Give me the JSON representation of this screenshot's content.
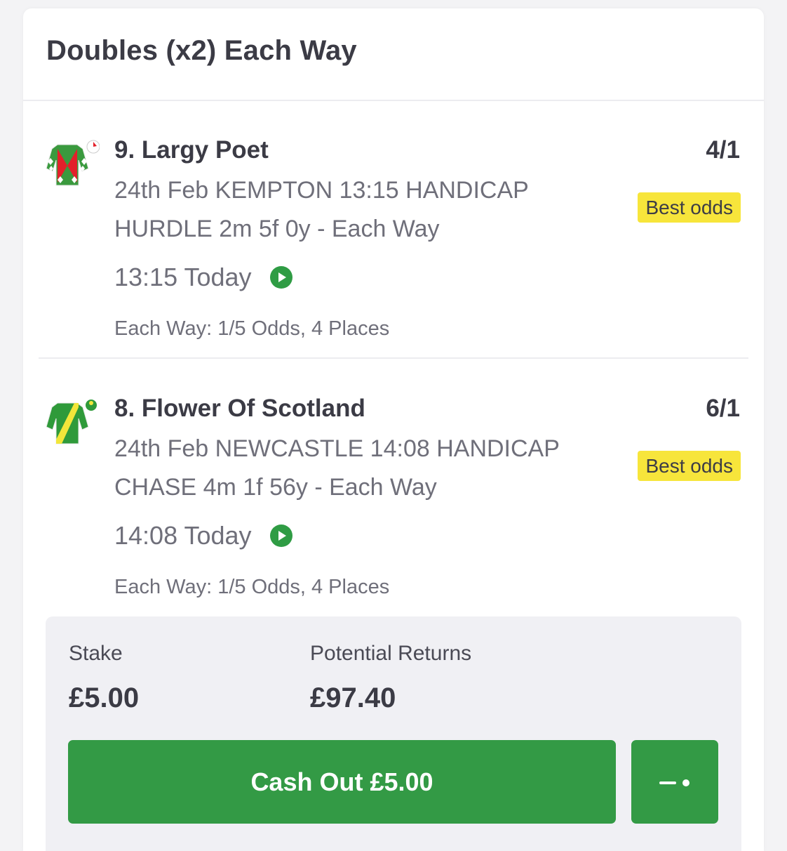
{
  "header": {
    "title": "Doubles (x2) Each Way"
  },
  "selections": [
    {
      "name": "9. Largy Poet",
      "odds": "4/1",
      "event": "24th Feb KEMPTON 13:15 HANDICAP HURDLE 2m 5f 0y - Each Way",
      "badge": "Best odds",
      "time": "13:15 Today",
      "each_way_terms": "Each Way: 1/5 Odds, 4 Places",
      "silk_icon": "jockey-silks-icon",
      "colors": {
        "body": "#3a9a3e",
        "accent": "#e3202a",
        "cap": "#ffffff"
      }
    },
    {
      "name": "8. Flower Of Scotland",
      "odds": "6/1",
      "event": "24th Feb NEWCASTLE 14:08 HANDICAP CHASE 4m 1f 56y - Each Way",
      "badge": "Best odds",
      "time": "14:08 Today",
      "each_way_terms": "Each Way: 1/5 Odds, 4 Places",
      "silk_icon": "jockey-silks-icon",
      "colors": {
        "body": "#2f9a3a",
        "accent": "#f2e63a",
        "cap": "#2f9a3a"
      }
    }
  ],
  "bet": {
    "stake_label": "Stake",
    "stake_value": "£5.00",
    "returns_label": "Potential Returns",
    "returns_value": "£97.40",
    "cashout_label": "Cash Out £5.00",
    "slider_icon": "partial-cashout-slider-icon"
  },
  "theme": {
    "primary_green": "#339a45",
    "badge_yellow": "#f7e53b",
    "text_dark": "#3b3b45",
    "text_muted": "#6f6f7a"
  }
}
